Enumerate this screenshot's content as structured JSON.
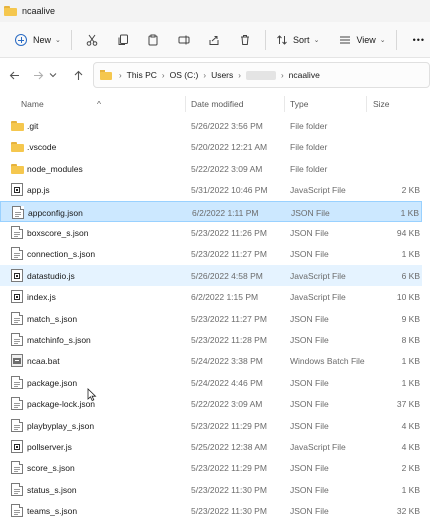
{
  "window": {
    "title": "ncaalive"
  },
  "toolbar": {
    "new_label": "New",
    "sort_label": "Sort",
    "view_label": "View",
    "more_label": "•••"
  },
  "address": {
    "crumbs": [
      "This PC",
      "OS (C:)",
      "Users",
      "ncaalive"
    ]
  },
  "columns": {
    "name": "Name",
    "date": "Date modified",
    "type": "Type",
    "size": "Size"
  },
  "files": [
    {
      "name": ".git",
      "date": "5/26/2022 3:56 PM",
      "type": "File folder",
      "size": "",
      "icon": "folder-icon"
    },
    {
      "name": ".vscode",
      "date": "5/20/2022 12:21 AM",
      "type": "File folder",
      "size": "",
      "icon": "folder-icon"
    },
    {
      "name": "node_modules",
      "date": "5/22/2022 3:09 AM",
      "type": "File folder",
      "size": "",
      "icon": "folder-icon"
    },
    {
      "name": "app.js",
      "date": "5/31/2022 10:46 PM",
      "type": "JavaScript File",
      "size": "2 KB",
      "icon": "js-file-icon"
    },
    {
      "name": "appconfig.json",
      "date": "6/2/2022 1:11 PM",
      "type": "JSON File",
      "size": "1 KB",
      "icon": "json-file-icon"
    },
    {
      "name": "boxscore_s.json",
      "date": "5/23/2022 11:26 PM",
      "type": "JSON File",
      "size": "94 KB",
      "icon": "json-file-icon"
    },
    {
      "name": "connection_s.json",
      "date": "5/23/2022 11:27 PM",
      "type": "JSON File",
      "size": "1 KB",
      "icon": "json-file-icon"
    },
    {
      "name": "datastudio.js",
      "date": "5/26/2022 4:58 PM",
      "type": "JavaScript File",
      "size": "6 KB",
      "icon": "js-file-icon"
    },
    {
      "name": "index.js",
      "date": "6/2/2022 1:15 PM",
      "type": "JavaScript File",
      "size": "10 KB",
      "icon": "js-file-icon"
    },
    {
      "name": "match_s.json",
      "date": "5/23/2022 11:27 PM",
      "type": "JSON File",
      "size": "9 KB",
      "icon": "json-file-icon"
    },
    {
      "name": "matchinfo_s.json",
      "date": "5/23/2022 11:28 PM",
      "type": "JSON File",
      "size": "8 KB",
      "icon": "json-file-icon"
    },
    {
      "name": "ncaa.bat",
      "date": "5/24/2022 3:38 PM",
      "type": "Windows Batch File",
      "size": "1 KB",
      "icon": "batch-file-icon"
    },
    {
      "name": "package.json",
      "date": "5/24/2022 4:46 PM",
      "type": "JSON File",
      "size": "1 KB",
      "icon": "json-file-icon"
    },
    {
      "name": "package-lock.json",
      "date": "5/22/2022 3:09 AM",
      "type": "JSON File",
      "size": "37 KB",
      "icon": "json-file-icon"
    },
    {
      "name": "playbyplay_s.json",
      "date": "5/23/2022 11:29 PM",
      "type": "JSON File",
      "size": "4 KB",
      "icon": "json-file-icon"
    },
    {
      "name": "pollserver.js",
      "date": "5/25/2022 12:38 AM",
      "type": "JavaScript File",
      "size": "4 KB",
      "icon": "js-file-icon"
    },
    {
      "name": "score_s.json",
      "date": "5/23/2022 11:29 PM",
      "type": "JSON File",
      "size": "2 KB",
      "icon": "json-file-icon"
    },
    {
      "name": "status_s.json",
      "date": "5/23/2022 11:30 PM",
      "type": "JSON File",
      "size": "1 KB",
      "icon": "json-file-icon"
    },
    {
      "name": "teams_s.json",
      "date": "5/23/2022 11:30 PM",
      "type": "JSON File",
      "size": "32 KB",
      "icon": "json-file-icon"
    }
  ],
  "selected_file": "appconfig.json",
  "hovered_file": "datastudio.js",
  "colors": {
    "selection": "#cce8ff",
    "selection_border": "#99d1ff",
    "hover": "#e5f3ff",
    "folder": "#f5c74e"
  }
}
